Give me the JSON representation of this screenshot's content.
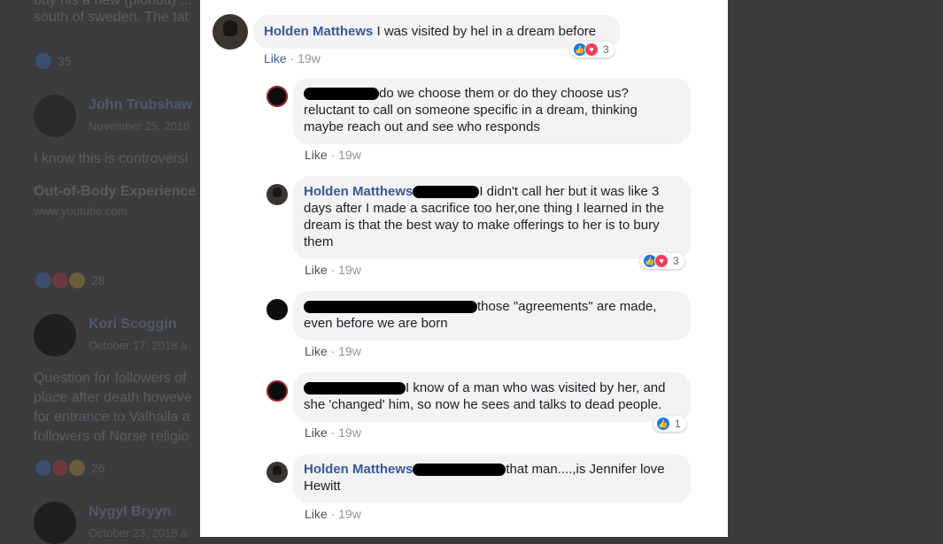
{
  "background": {
    "lines": [
      {
        "text": "buy his a new (plohutt) ..."
      },
      {
        "text": "south of sweden. The tat"
      },
      {
        "text": "35"
      },
      {
        "text": "John Trubshaw"
      },
      {
        "text": "November 25, 2018"
      },
      {
        "text": "I know this is controversi"
      },
      {
        "text": "Out-of-Body Experience"
      },
      {
        "text": "www.youtube.com"
      },
      {
        "text": "28"
      },
      {
        "text": "Kori Scoggin"
      },
      {
        "text": "October 17, 2018 a"
      },
      {
        "text": "Question for followers of"
      },
      {
        "text": "place after death howeve"
      },
      {
        "text": "for entrance to Valhalla a"
      },
      {
        "text": "followers of Norse religio"
      },
      {
        "text": "26"
      },
      {
        "text": "Nygyl Bryyn"
      },
      {
        "text": "October 23, 2018 a"
      }
    ]
  },
  "thread": {
    "main": {
      "author": "Holden Matthews",
      "text": "I was visited by hel in a dream before",
      "like": "Like",
      "sep": "·",
      "time": "19w",
      "reaction_count": "3"
    },
    "replies": [
      {
        "author": "",
        "text_lines": [
          "do we choose them or do they choose us?",
          "reluctant to call on someone specific in a dream, thinking",
          "maybe reach out and see who responds"
        ],
        "like": "Like",
        "sep": "·",
        "time": "19w"
      },
      {
        "author": "Holden Matthews",
        "text_lines": [
          "I didn't call her but it was like 3",
          "days after I made a sacrifice too her,one thing I learned in the",
          "dream is that the best way to make offerings to her is to bury",
          "them"
        ],
        "like": "Like",
        "sep": "·",
        "time": "19w",
        "reaction_count": "3"
      },
      {
        "author": "",
        "text_lines": [
          "those \"agreements\" are made,",
          "even before we are born"
        ],
        "like": "Like",
        "sep": "·",
        "time": "19w"
      },
      {
        "author": "",
        "text_lines": [
          "I know of a man who was visited by her, and",
          "she 'changed' him, so now he sees and talks to dead people."
        ],
        "like": "Like",
        "sep": "·",
        "time": "19w",
        "reaction_count": "1"
      },
      {
        "author": "Holden Matthews",
        "text_lines": [
          "that man....,is Jennifer love",
          "Hewitt"
        ],
        "like": "Like",
        "sep": "·",
        "time": "19w"
      }
    ]
  },
  "colors": {
    "author": "#385898",
    "bubble": "#f2f3f5",
    "like_reaction": "#1877f2",
    "love_reaction": "#f33e58"
  }
}
